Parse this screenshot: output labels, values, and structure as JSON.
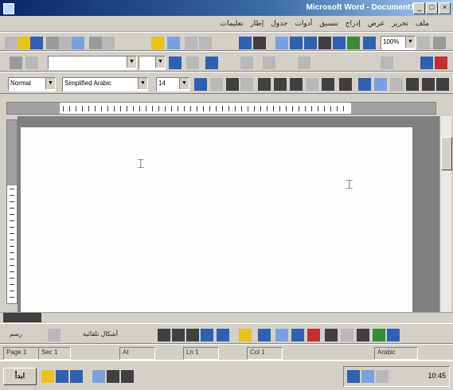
{
  "window": {
    "title": "Microsoft Word - Document1",
    "buttons": [
      "_",
      "□",
      "×"
    ]
  },
  "menubar": {
    "items": [
      "ملف",
      "تحرير",
      "عرض",
      "إدراج",
      "تنسيق",
      "أدوات",
      "جدول",
      "إطار",
      "تعليمات"
    ]
  },
  "formatting": {
    "style_value": "Normal",
    "font_value": "Simplified Arabic",
    "size_value": "14",
    "zoom_value": "100%"
  },
  "statusbar": {
    "page": "Page 1",
    "section": "Sec 1",
    "position": "At",
    "line": "Ln 1",
    "col": "Col 1",
    "language": "Arabic"
  },
  "drawing": {
    "draw_label": "رسم",
    "autoshapes_label": "أشكال تلقائية"
  },
  "taskbar": {
    "start_label": "ابدأ",
    "clock": "10:45"
  },
  "colors": {
    "title_start": "#0a246a",
    "title_end": "#a6caf0",
    "chrome": "#d4d0c8",
    "page": "#fffdfd"
  }
}
